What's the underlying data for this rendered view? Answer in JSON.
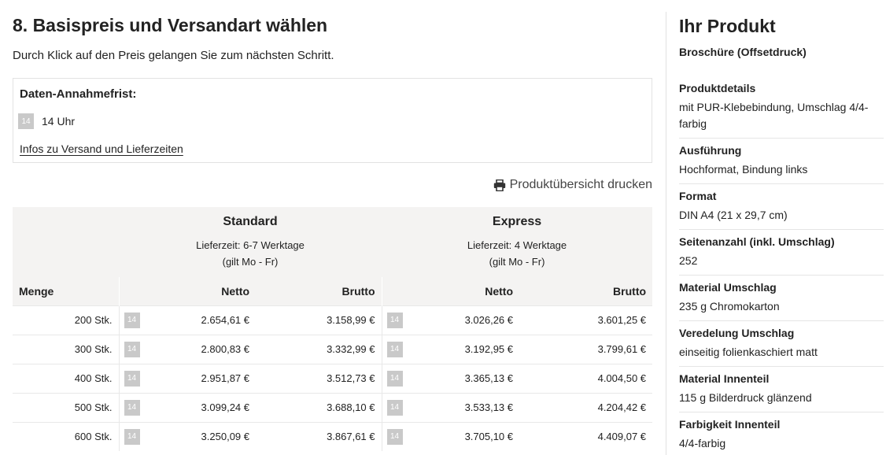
{
  "page": {
    "title": "8. Basispreis und Versandart wählen",
    "subtitle": "Durch Klick auf den Preis gelangen Sie zum nächsten Schritt."
  },
  "deadline": {
    "title": "Daten-Annahmefrist:",
    "badge": "14",
    "time": "14 Uhr",
    "link": "Infos zu Versand und Lieferzeiten"
  },
  "print": {
    "label": "Produktübersicht drucken",
    "icon": "printer-icon"
  },
  "options": {
    "standard": {
      "name": "Standard",
      "time": "Lieferzeit: 6-7 Werktage",
      "note": "(gilt Mo - Fr)"
    },
    "express": {
      "name": "Express",
      "time": "Lieferzeit: 4 Werktage",
      "note": "(gilt Mo - Fr)"
    }
  },
  "table": {
    "col_menge": "Menge",
    "col_netto": "Netto",
    "col_brutto": "Brutto",
    "rows": [
      {
        "qty": "200 Stk.",
        "badge": "14",
        "std_netto": "2.654,61 €",
        "std_brutto": "3.158,99 €",
        "exp_badge": "14",
        "exp_netto": "3.026,26 €",
        "exp_brutto": "3.601,25 €"
      },
      {
        "qty": "300 Stk.",
        "badge": "14",
        "std_netto": "2.800,83 €",
        "std_brutto": "3.332,99 €",
        "exp_badge": "14",
        "exp_netto": "3.192,95 €",
        "exp_brutto": "3.799,61 €"
      },
      {
        "qty": "400 Stk.",
        "badge": "14",
        "std_netto": "2.951,87 €",
        "std_brutto": "3.512,73 €",
        "exp_badge": "14",
        "exp_netto": "3.365,13 €",
        "exp_brutto": "4.004,50 €"
      },
      {
        "qty": "500 Stk.",
        "badge": "14",
        "std_netto": "3.099,24 €",
        "std_brutto": "3.688,10 €",
        "exp_badge": "14",
        "exp_netto": "3.533,13 €",
        "exp_brutto": "4.204,42 €"
      },
      {
        "qty": "600 Stk.",
        "badge": "14",
        "std_netto": "3.250,09 €",
        "std_brutto": "3.867,61 €",
        "exp_badge": "14",
        "exp_netto": "3.705,10 €",
        "exp_brutto": "4.409,07 €"
      }
    ]
  },
  "sidebar": {
    "title": "Ihr Produkt",
    "product": "Broschüre (Offsetdruck)",
    "specs": [
      {
        "label": "Produktdetails",
        "value": "mit PUR-Klebebindung, Umschlag 4/4-farbig"
      },
      {
        "label": "Ausführung",
        "value": "Hochformat, Bindung links"
      },
      {
        "label": "Format",
        "value": "DIN A4 (21 x 29,7 cm)"
      },
      {
        "label": "Seitenanzahl (inkl. Umschlag)",
        "value": "252"
      },
      {
        "label": "Material Umschlag",
        "value": "235 g Chromokarton"
      },
      {
        "label": "Veredelung Umschlag",
        "value": "einseitig folienkaschiert matt"
      },
      {
        "label": "Material Innenteil",
        "value": "115 g Bilderdruck glänzend"
      },
      {
        "label": "Farbigkeit Innenteil",
        "value": "4/4-farbig"
      }
    ]
  }
}
